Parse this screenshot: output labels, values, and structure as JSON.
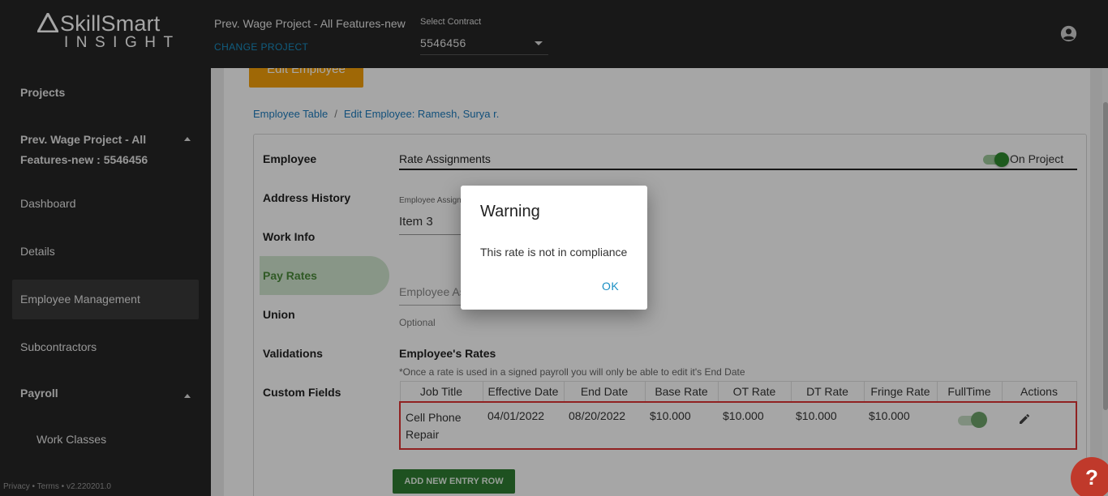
{
  "header": {
    "logo_text": "SkillSmart",
    "logo_sub": "INSIGHT",
    "project_name": "Prev. Wage Project - All Features-new",
    "change_project": "CHANGE PROJECT",
    "contract_label": "Select Contract",
    "contract_value": "5546456",
    "user_icon": "account-circle-icon"
  },
  "sidebar": {
    "items": [
      {
        "label": "Projects"
      },
      {
        "label": "Prev. Wage Project - All Features-new : 5546456"
      },
      {
        "label": "Dashboard"
      },
      {
        "label": "Details"
      },
      {
        "label": "Employee Management"
      },
      {
        "label": "Subcontractors"
      },
      {
        "label": "Payroll"
      },
      {
        "label": "Work Classes"
      }
    ],
    "footer": "Privacy • Terms • v2.220201.0"
  },
  "main": {
    "edit_button": "Edit Employee",
    "breadcrumb": [
      "Employee Table",
      "Edit Employee: Ramesh, Surya r."
    ],
    "tabs": [
      {
        "label": "Employee"
      },
      {
        "label": "Address History"
      },
      {
        "label": "Work Info"
      },
      {
        "label": "Pay Rates"
      },
      {
        "label": "Union"
      },
      {
        "label": "Validations"
      },
      {
        "label": "Custom Fields"
      }
    ],
    "active_tab": "Pay Rates",
    "section_title": "Rate Assignments",
    "on_project_label": "On Project",
    "on_project_toggle": true,
    "employee_assignment_label": "Employee Assignme",
    "employee_assignment_value": "Item 3",
    "employee_assignment2_placeholder": "Employee Assi",
    "optional_text": "Optional",
    "rates_title": "Employee's Rates",
    "rates_note": "*Once a rate is used in a signed payroll you will only be able to edit it's End Date",
    "table": {
      "headers": [
        "Job Title",
        "Effective Date",
        "End Date",
        "Base Rate",
        "OT Rate",
        "DT Rate",
        "Fringe Rate",
        "FullTime",
        "Actions"
      ],
      "rows": [
        {
          "job_title": "Cell Phone Repair",
          "effective_date": "04/01/2022",
          "end_date": "08/20/2022",
          "base_rate": "$10.000",
          "ot_rate": "$10.000",
          "dt_rate": "$10.000",
          "fringe_rate": "$10.000",
          "fulltime": true,
          "action_icon": "pencil-icon"
        }
      ]
    },
    "add_row_button": "ADD NEW ENTRY ROW"
  },
  "dialog": {
    "title": "Warning",
    "message": "This rate is not in compliance",
    "ok_label": "OK"
  },
  "help_button": "?",
  "colors": {
    "topbar": "#262626",
    "accent_blue": "#1a8fc4",
    "green": "#2e7d32",
    "orange": "#f5a00a",
    "error_red": "#d33"
  }
}
